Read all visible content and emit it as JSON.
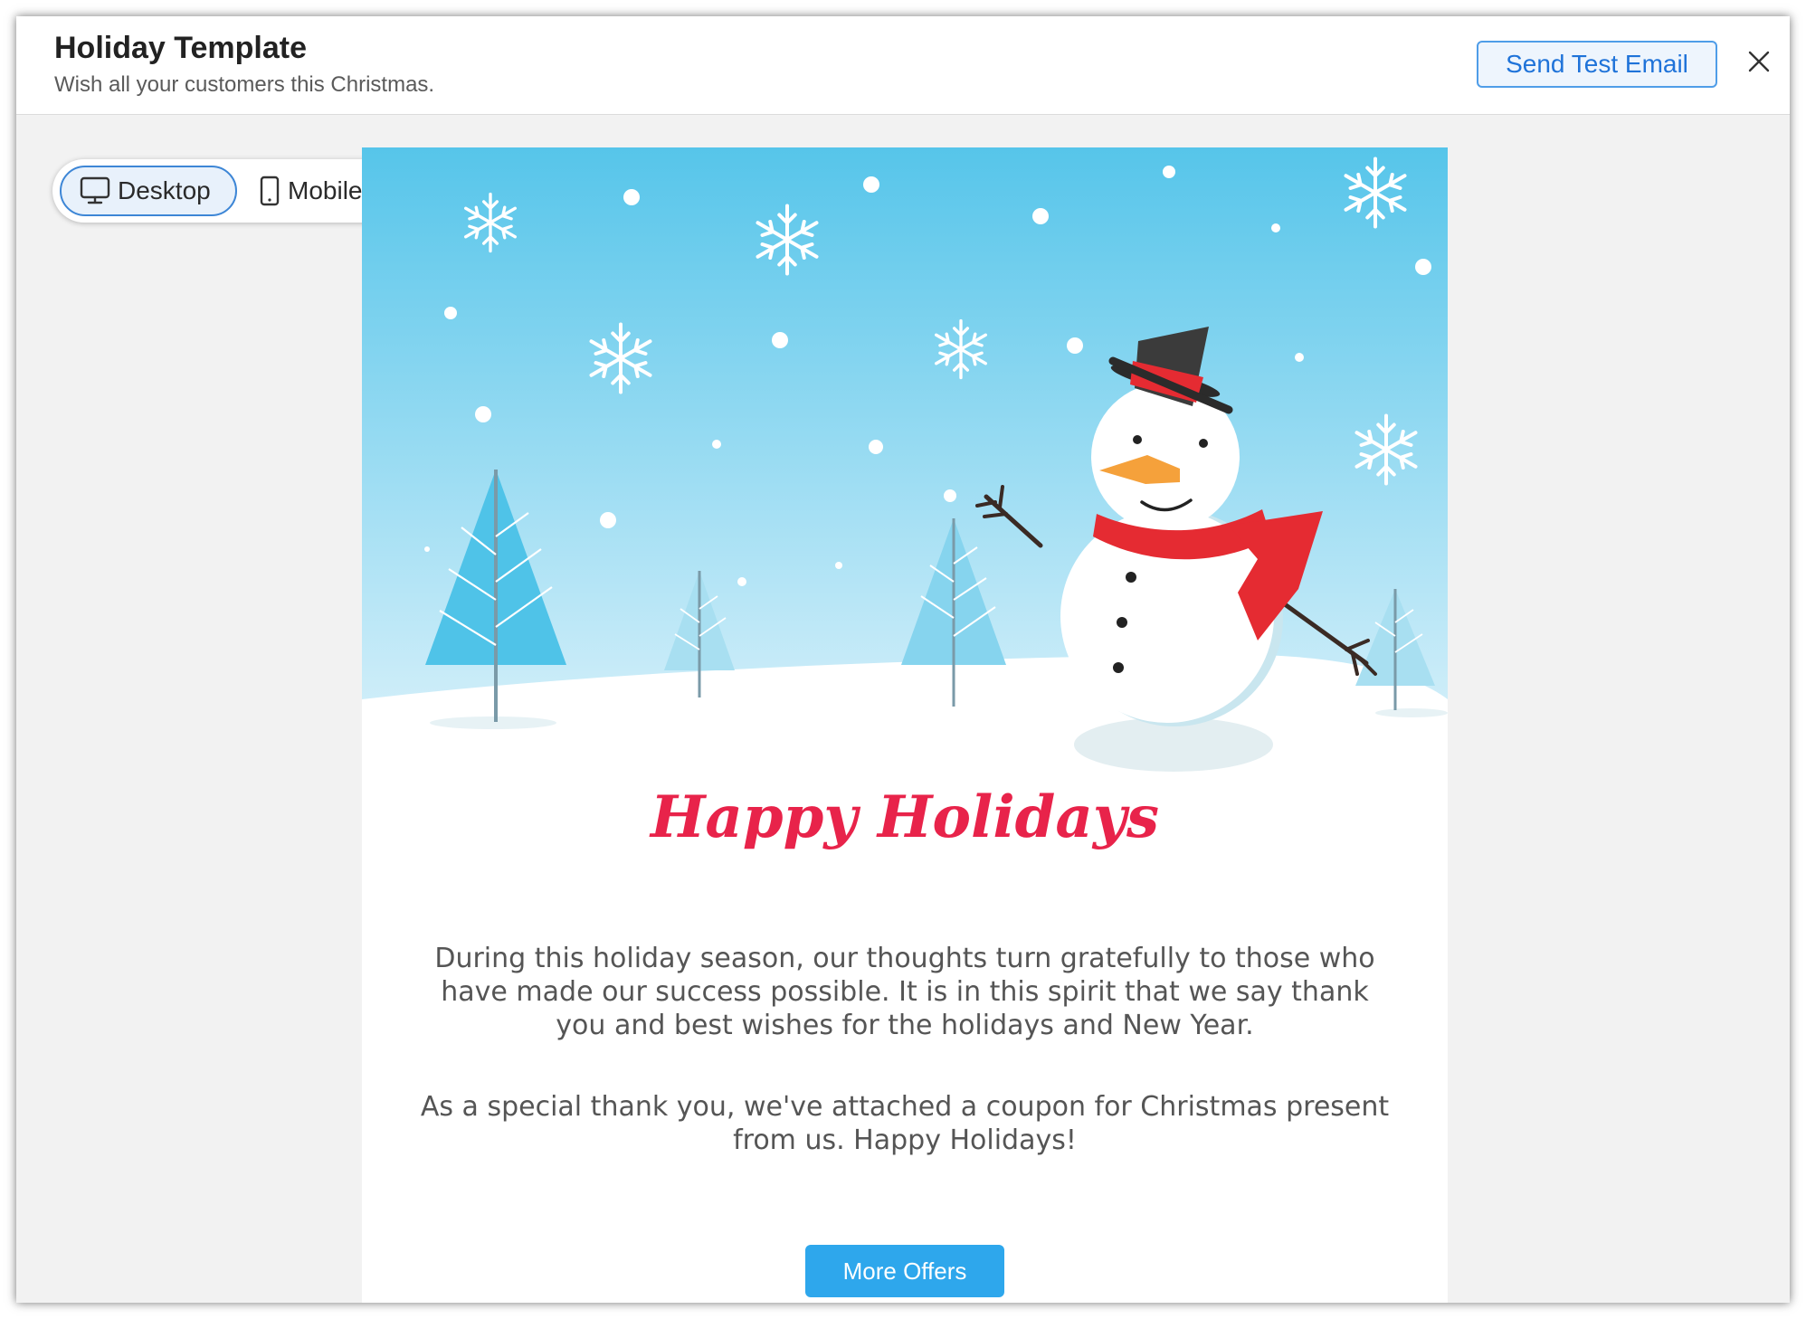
{
  "header": {
    "title": "Holiday Template",
    "subtitle": "Wish all your customers this Christmas.",
    "send_test_label": "Send Test Email"
  },
  "view_toggle": {
    "options": [
      {
        "label": "Desktop",
        "icon": "desktop-monitor-icon",
        "selected": true
      },
      {
        "label": "Mobile",
        "icon": "mobile-phone-icon",
        "selected": false
      }
    ]
  },
  "email": {
    "headline": "Happy Holidays",
    "paragraph1": "During this holiday season, our thoughts turn gratefully to those who have made our success possible. It is in this spirit that we say thank you and best wishes for the holidays and New Year.",
    "paragraph2": "As a special thank you, we've attached a coupon for Christmas present from us. Happy Holidays!",
    "cta_label": "More Offers"
  },
  "colors": {
    "accent": "#1f73d9",
    "cta": "#2ea7ec",
    "headline": "#e8234a",
    "sky_top": "#56c5ea",
    "scarf": "#e52b32"
  }
}
